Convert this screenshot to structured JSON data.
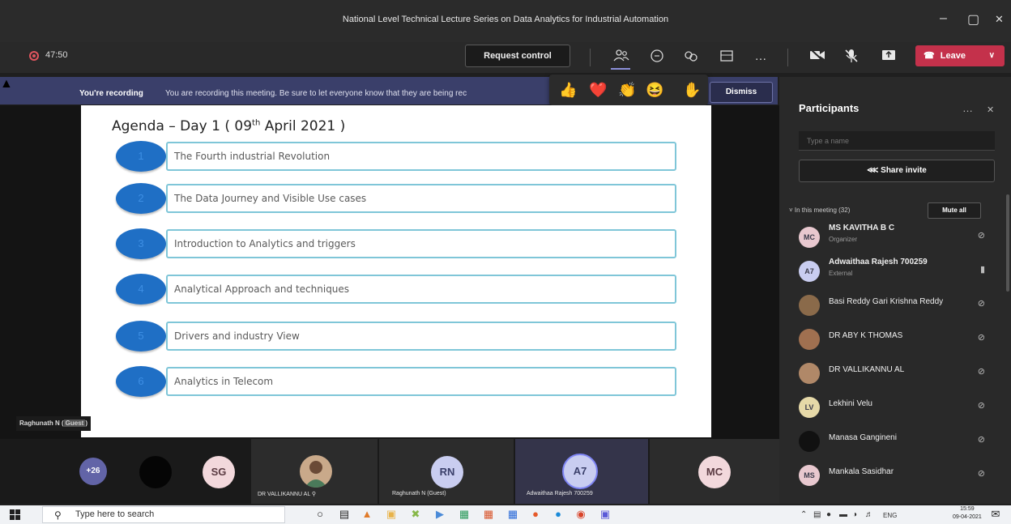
{
  "window": {
    "title": "National Level Technical Lecture Series on Data Analytics for Industrial Automation",
    "minimize": "–",
    "maximize": "▢",
    "close": "✕"
  },
  "toolbar": {
    "timer": "47:50",
    "request_control": "Request control",
    "more": "…",
    "leave": "Leave",
    "leave_chevron": "∨",
    "icons": [
      "people-icon",
      "chat-icon",
      "raise-hand-icon",
      "share-tray-icon",
      "more-icon",
      "camera-off-icon",
      "mic-off-icon",
      "share-screen-icon"
    ]
  },
  "banner": {
    "strong": "You're recording",
    "text": "You are recording this meeting. Be sure to let everyone know that they are being rec",
    "dismiss": "Dismiss"
  },
  "reactions": [
    "👍",
    "❤️",
    "👏",
    "😆",
    "✋"
  ],
  "slide": {
    "title": "Agenda – Day 1 ( 09",
    "title_sup": "th",
    "title_end": " April 2021 )",
    "items": [
      {
        "num": "1",
        "label": "The Fourth industrial Revolution"
      },
      {
        "num": "2",
        "label": "The Data Journey and Visible Use cases"
      },
      {
        "num": "3",
        "label": "Introduction to Analytics and triggers"
      },
      {
        "num": "4",
        "label": "Analytical Approach and techniques"
      },
      {
        "num": "5",
        "label": "Drivers and industry View"
      },
      {
        "num": "6",
        "label": "Analytics in Telecom"
      }
    ]
  },
  "speaker": {
    "name": "Raghunath N (",
    "guest": "Guest",
    "end": ")"
  },
  "gallery": {
    "more": "+26",
    "sg": "SG",
    "tile1_name": "DR VALLIKANNU AL",
    "tile2_initials": "RN",
    "tile2_name": "Raghunath N (Guest)",
    "tile3_initials": "A7",
    "tile3_name": "Adwaithaa Rajesh 700259",
    "tile4_initials": "MC"
  },
  "panel": {
    "title": "Participants",
    "more": "…",
    "close": "✕",
    "search_placeholder": "Type a name",
    "share_invite": "Share invite",
    "in_meeting": "˅ In this meeting (32)",
    "mute_all": "Mute all",
    "participants": [
      {
        "initials": "MC",
        "name": "MS KAVITHA B C",
        "role": "Organizer",
        "color": "#e8c8cf"
      },
      {
        "initials": "A7",
        "name": "Adwaithaa Rajesh 700259",
        "role": "External",
        "color": "#c9cdf0"
      },
      {
        "initials": "",
        "name": "Basi Reddy Gari Krishna Reddy",
        "role": "",
        "color": "#8a6a4a"
      },
      {
        "initials": "",
        "name": "DR ABY K THOMAS",
        "role": "",
        "color": "#a07050"
      },
      {
        "initials": "",
        "name": "DR VALLIKANNU AL",
        "role": "",
        "color": "#b08868"
      },
      {
        "initials": "LV",
        "name": "Lekhini Velu",
        "role": "",
        "color": "#e6d9a8"
      },
      {
        "initials": "",
        "name": "Manasa Gangineni",
        "role": "",
        "color": "#111111"
      },
      {
        "initials": "MS",
        "name": "Mankala Sasidhar",
        "role": "",
        "color": "#e8c8cf"
      }
    ]
  },
  "taskbar": {
    "search_placeholder": "Type here to search",
    "lang": "ENG",
    "time": "15:59",
    "date": "09-04-2021"
  },
  "colors": {
    "leave": "#c4314b",
    "banner": "#3a3f6a",
    "agenda_circle": "#1f6fc5",
    "agenda_border": "#7fc6d8"
  }
}
